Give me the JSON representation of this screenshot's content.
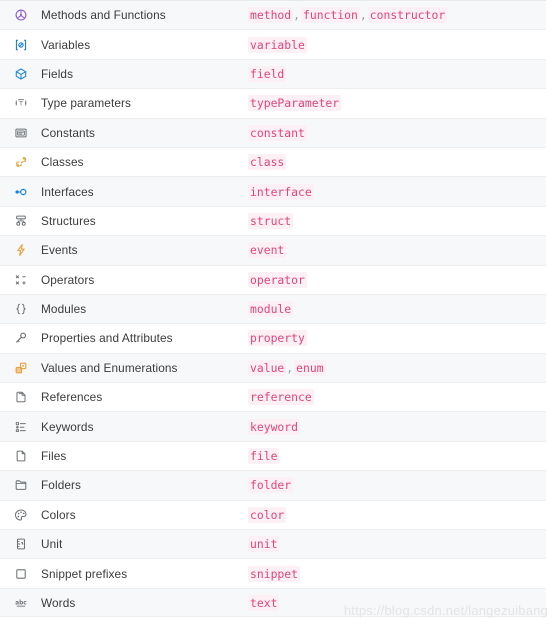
{
  "table": {
    "rows": [
      {
        "icon": "methods-and-functions-icon",
        "label": "Methods and Functions",
        "codes": [
          "method",
          "function",
          "constructor"
        ]
      },
      {
        "icon": "variables-icon",
        "label": "Variables",
        "codes": [
          "variable"
        ]
      },
      {
        "icon": "fields-icon",
        "label": "Fields",
        "codes": [
          "field"
        ]
      },
      {
        "icon": "type-parameters-icon",
        "label": "Type parameters",
        "codes": [
          "typeParameter"
        ]
      },
      {
        "icon": "constants-icon",
        "label": "Constants",
        "codes": [
          "constant"
        ]
      },
      {
        "icon": "classes-icon",
        "label": "Classes",
        "codes": [
          "class"
        ]
      },
      {
        "icon": "interfaces-icon",
        "label": "Interfaces",
        "codes": [
          "interface"
        ]
      },
      {
        "icon": "structures-icon",
        "label": "Structures",
        "codes": [
          "struct"
        ]
      },
      {
        "icon": "events-icon",
        "label": "Events",
        "codes": [
          "event"
        ]
      },
      {
        "icon": "operators-icon",
        "label": "Operators",
        "codes": [
          "operator"
        ]
      },
      {
        "icon": "modules-icon",
        "label": "Modules",
        "codes": [
          "module"
        ]
      },
      {
        "icon": "properties-and-attributes-icon",
        "label": "Properties and Attributes",
        "codes": [
          "property"
        ]
      },
      {
        "icon": "values-and-enumerations-icon",
        "label": "Values and Enumerations",
        "codes": [
          "value",
          "enum"
        ]
      },
      {
        "icon": "references-icon",
        "label": "References",
        "codes": [
          "reference"
        ]
      },
      {
        "icon": "keywords-icon",
        "label": "Keywords",
        "codes": [
          "keyword"
        ]
      },
      {
        "icon": "files-icon",
        "label": "Files",
        "codes": [
          "file"
        ]
      },
      {
        "icon": "folders-icon",
        "label": "Folders",
        "codes": [
          "folder"
        ]
      },
      {
        "icon": "colors-icon",
        "label": "Colors",
        "codes": [
          "color"
        ]
      },
      {
        "icon": "unit-icon",
        "label": "Unit",
        "codes": [
          "unit"
        ]
      },
      {
        "icon": "snippet-prefixes-icon",
        "label": "Snippet prefixes",
        "codes": [
          "snippet"
        ]
      },
      {
        "icon": "words-icon",
        "label": "Words",
        "codes": [
          "text"
        ]
      }
    ],
    "separator": ","
  },
  "watermark": {
    "text": "https://blog.csdn.net/langezuibang"
  },
  "colors": {
    "code_text": "#e0457b",
    "code_bg": "#fdf0f5",
    "label_text": "#3b3b3b",
    "row_alt_bg": "#f7f8f9",
    "row_border": "#eceef0",
    "icon_purple": "#8f5fd4",
    "icon_blue": "#1a82d8",
    "icon_gray": "#6e7276",
    "icon_orange": "#e8a33d",
    "watermark": "#e2e4e6"
  }
}
